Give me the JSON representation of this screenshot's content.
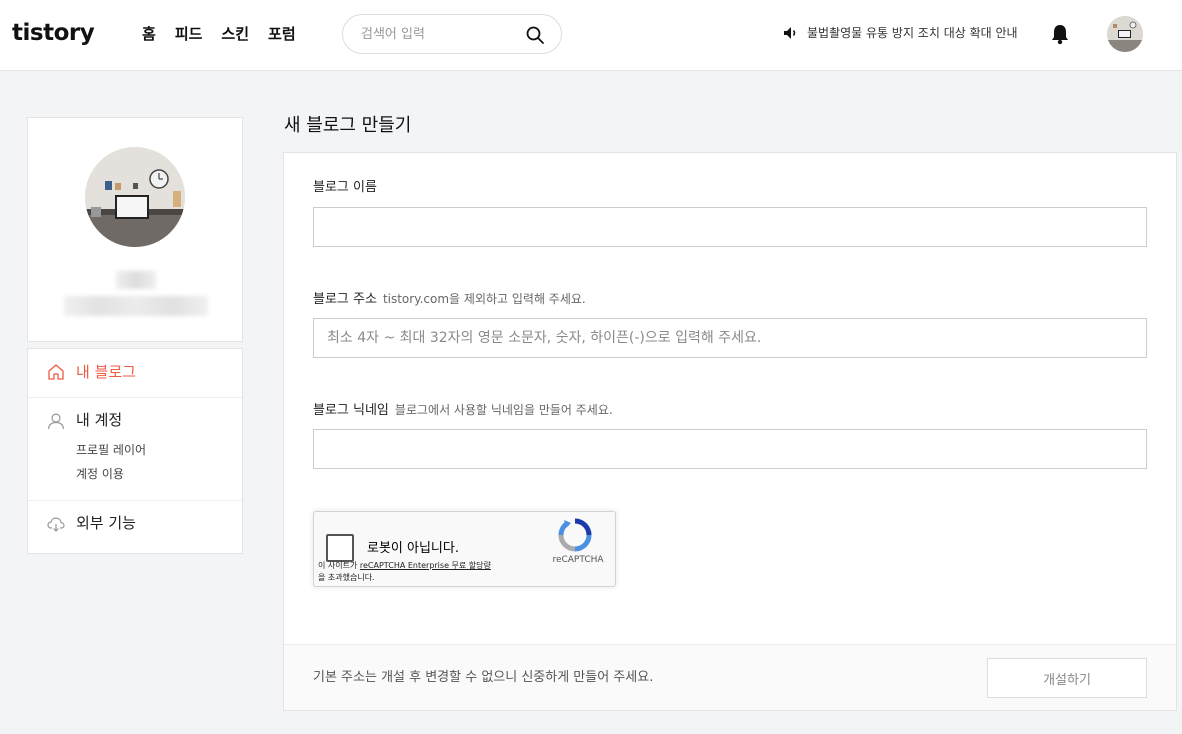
{
  "header": {
    "logo": "tistory",
    "nav": [
      "홈",
      "피드",
      "스킨",
      "포럼"
    ],
    "search_placeholder": "검색어 입력",
    "notice": "불법촬영물 유통 방지 조치 대상 확대 안내"
  },
  "sidebar": {
    "menu": {
      "my_blog": "내 블로그",
      "my_account": "내 계정",
      "account_sub": [
        "프로필 레이어",
        "계정 이용"
      ],
      "external": "외부 기능"
    }
  },
  "main": {
    "title": "새 블로그 만들기",
    "fields": {
      "name_label": "블로그 이름",
      "address_label": "블로그 주소",
      "address_hint": "tistory.com을 제외하고 입력해 주세요.",
      "address_placeholder": "최소 4자 ~ 최대 32자의 영문 소문자, 숫자, 하이픈(-)으로 입력해 주세요.",
      "nickname_label": "블로그 닉네임",
      "nickname_hint": "블로그에서 사용할 닉네임을 만들어 주세요."
    },
    "captcha": {
      "label": "로봇이 아닙니다.",
      "brand": "reCAPTCHA",
      "terms_prefix": "이 사이트가 ",
      "terms_link": "reCAPTCHA Enterprise 무료 할당량",
      "terms_suffix": "을 초과했습니다."
    },
    "footer_note": "기본 주소는 개설 후 변경할 수 없으니 신중하게 만들어 주세요.",
    "create_button": "개설하기"
  }
}
